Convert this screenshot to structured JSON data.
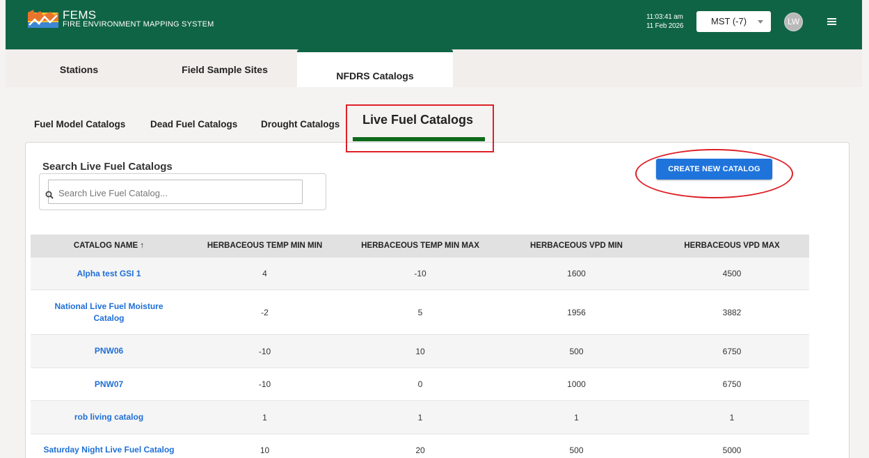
{
  "header": {
    "app_name": "FEMS",
    "app_subtitle": "FIRE ENVIRONMENT MAPPING SYSTEM",
    "time": "11:03:41 am",
    "date": "11 Feb 2026",
    "timezone": "MST (-7)",
    "avatar_initials": "LW",
    "brand_color": "#106446"
  },
  "top_tabs": [
    "Stations",
    "Field Sample Sites",
    "NFDRS Catalogs"
  ],
  "sub_tabs": [
    "Fuel Model Catalogs",
    "Dead Fuel Catalogs",
    "Drought Catalogs",
    "Live Fuel Catalogs"
  ],
  "search": {
    "title": "Search Live Fuel Catalogs",
    "placeholder": "Search Live Fuel Catalog..."
  },
  "create_button": "CREATE NEW CATALOG",
  "table": {
    "columns": [
      "CATALOG NAME ↑",
      "HERBACEOUS TEMP MIN MIN",
      "HERBACEOUS TEMP MIN MAX",
      "HERBACEOUS VPD MIN",
      "HERBACEOUS VPD MAX"
    ],
    "rows": [
      [
        "Alpha test GSI 1",
        "4",
        "-10",
        "1600",
        "4500"
      ],
      [
        "National Live Fuel Moisture Catalog",
        "-2",
        "5",
        "1956",
        "3882"
      ],
      [
        "PNW06",
        "-10",
        "10",
        "500",
        "6750"
      ],
      [
        "PNW07",
        "-10",
        "0",
        "1000",
        "6750"
      ],
      [
        "rob living catalog",
        "1",
        "1",
        "1",
        "1"
      ],
      [
        "Saturday Night Live Fuel Catalog",
        "10",
        "20",
        "500",
        "5000"
      ]
    ]
  },
  "annotation_color": "#dd1f26",
  "accent_color": "#1f74dc"
}
